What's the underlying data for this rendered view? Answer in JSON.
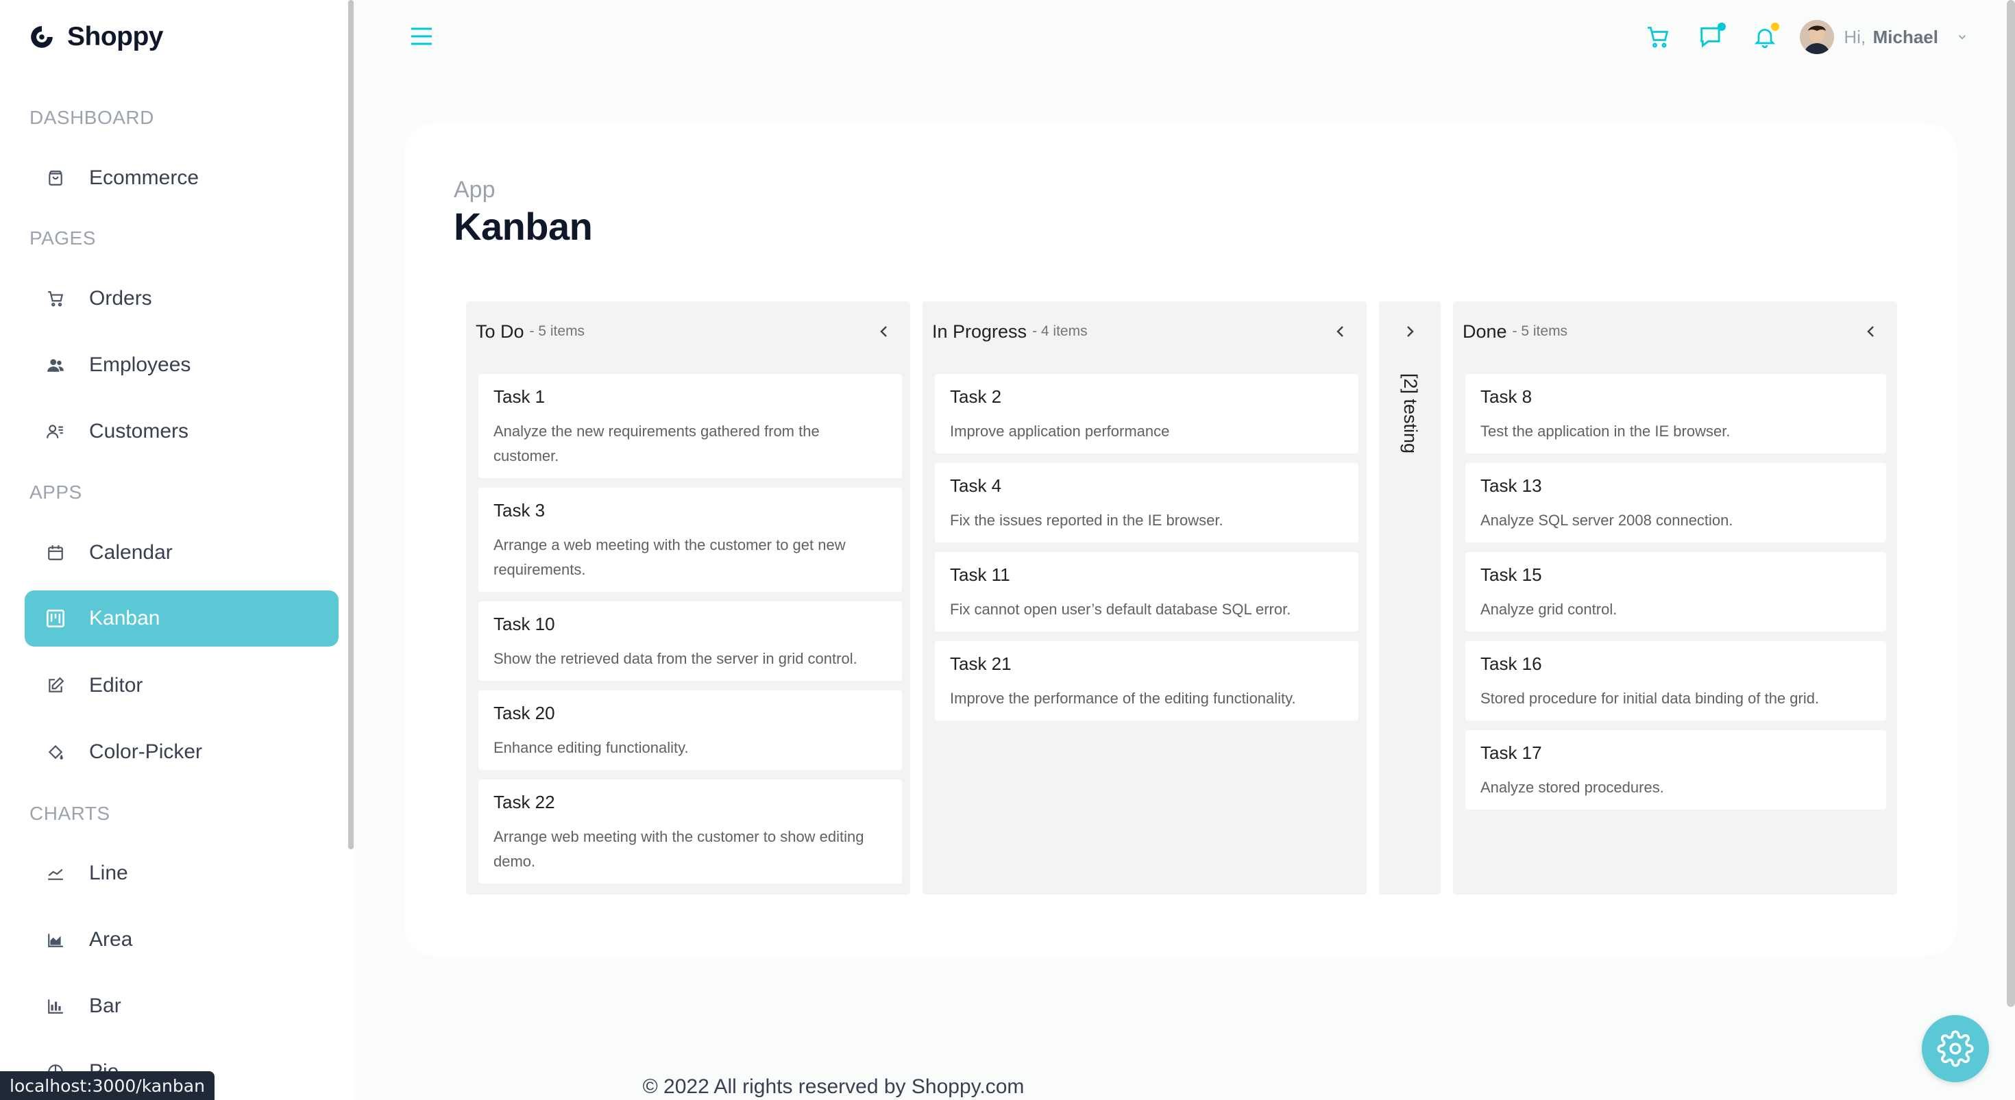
{
  "app": {
    "name": "Shoppy"
  },
  "sidebar": {
    "sections": [
      {
        "label": "DASHBOARD",
        "items": [
          {
            "label": "Ecommerce",
            "icon": "shopping-bag-icon"
          }
        ]
      },
      {
        "label": "PAGES",
        "items": [
          {
            "label": "Orders",
            "icon": "cart-icon"
          },
          {
            "label": "Employees",
            "icon": "employees-icon"
          },
          {
            "label": "Customers",
            "icon": "customers-icon"
          }
        ]
      },
      {
        "label": "APPS",
        "items": [
          {
            "label": "Calendar",
            "icon": "calendar-icon"
          },
          {
            "label": "Kanban",
            "icon": "kanban-icon",
            "active": true
          },
          {
            "label": "Editor",
            "icon": "edit-icon"
          },
          {
            "label": "Color-Picker",
            "icon": "paint-bucket-icon"
          }
        ]
      },
      {
        "label": "CHARTS",
        "items": [
          {
            "label": "Line",
            "icon": "line-chart-icon"
          },
          {
            "label": "Area",
            "icon": "area-chart-icon"
          },
          {
            "label": "Bar",
            "icon": "bar-chart-icon"
          },
          {
            "label": "Pie",
            "icon": "pie-chart-icon"
          }
        ]
      }
    ]
  },
  "status_url": "localhost:3000/kanban",
  "topbar": {
    "greeting": "Hi,",
    "user_name": "Michael",
    "accent": "#03C9D7",
    "chat_dot_color": "#03C9D7",
    "bell_dot_color": "#FEC90F"
  },
  "page": {
    "category": "App",
    "title": "Kanban"
  },
  "kanban": {
    "columns": [
      {
        "title": "To Do",
        "count": "- 5 items",
        "cards": [
          {
            "id": "Task 1",
            "summary": "Analyze the new requirements gathered from the customer."
          },
          {
            "id": "Task 3",
            "summary": "Arrange a web meeting with the customer to get new requirements."
          },
          {
            "id": "Task 10",
            "summary": "Show the retrieved data from the server in grid control."
          },
          {
            "id": "Task 20",
            "summary": "Enhance editing functionality."
          },
          {
            "id": "Task 22",
            "summary": "Arrange web meeting with the customer to show editing demo."
          }
        ]
      },
      {
        "title": "In Progress",
        "count": "- 4 items",
        "cards": [
          {
            "id": "Task 2",
            "summary": "Improve application performance"
          },
          {
            "id": "Task 4",
            "summary": "Fix the issues reported in the IE browser."
          },
          {
            "id": "Task 11",
            "summary": "Fix cannot open user’s default database SQL error."
          },
          {
            "id": "Task 21",
            "summary": "Improve the performance of the editing functionality."
          }
        ]
      },
      {
        "title": "Done",
        "count": "- 5 items",
        "cards": [
          {
            "id": "Task 8",
            "summary": "Test the application in the IE browser."
          },
          {
            "id": "Task 13",
            "summary": "Analyze SQL server 2008 connection."
          },
          {
            "id": "Task 15",
            "summary": "Analyze grid control."
          },
          {
            "id": "Task 16",
            "summary": "Stored procedure for initial data binding of the grid."
          },
          {
            "id": "Task 17",
            "summary": "Analyze stored procedures."
          }
        ]
      }
    ],
    "collapsed_column": {
      "label": "[2] testing"
    }
  },
  "footer": {
    "text": "© 2022 All rights reserved by Shoppy.com"
  }
}
